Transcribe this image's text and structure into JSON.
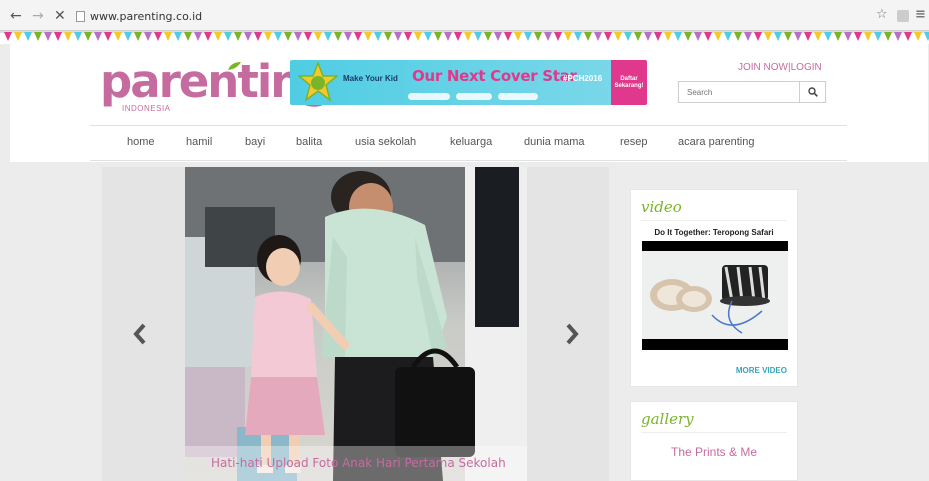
{
  "browser": {
    "back": "←",
    "forward": "→",
    "stop": "✕",
    "url": "www.parenting.co.id",
    "star": "☆",
    "menu": "≡"
  },
  "colors": {
    "brand_pink": "#c66b9f",
    "green": "#7ab529",
    "teal": "#3aa4b8",
    "banner_blue": "#4fcde3",
    "banner_pink": "#e0388d"
  },
  "logo": {
    "word": "parenting",
    "sub": "INDONESIA"
  },
  "banner": {
    "make": "Make Your Kid",
    "title": "Our Next Cover Star",
    "tag": "#PCH2016",
    "cta": "Daftar Sekarang!"
  },
  "auth": {
    "join": "JOIN NOW",
    "sep": "|",
    "login": "LOGIN"
  },
  "search": {
    "placeholder": "Search",
    "icon": "search-icon"
  },
  "nav": {
    "items": [
      "home",
      "hamil",
      "bayi",
      "balita",
      "usia sekolah",
      "keluarga",
      "dunia mama",
      "resep",
      "acara parenting"
    ]
  },
  "slider": {
    "caption": "Hati-hati Upload Foto Anak Hari Pertama Sekolah",
    "prev_icon": "chevron-left-icon",
    "next_icon": "chevron-right-icon"
  },
  "video": {
    "title": "video",
    "label": "Do It Together: Teropong Safari",
    "more": "MORE VIDEO"
  },
  "gallery": {
    "title": "gallery",
    "item": "The Prints & Me"
  }
}
